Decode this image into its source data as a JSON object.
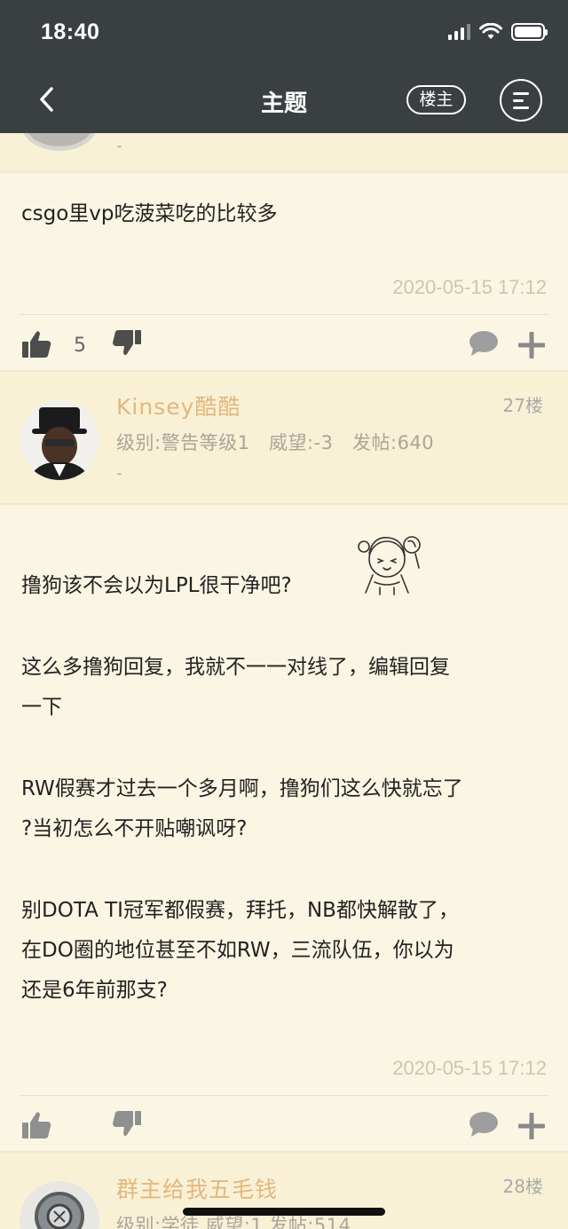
{
  "status": {
    "time": "18:40"
  },
  "nav": {
    "title": "主题",
    "louzhu_label": "楼主"
  },
  "prev_post": {
    "meta_dash": "-",
    "text": "csgo里vp吃菠菜吃的比较多",
    "timestamp": "2020-05-15 17:12",
    "likes": "5"
  },
  "post27": {
    "username": "Kinsey酷酷",
    "floor": "27楼",
    "level": "级别:警告等级1",
    "prestige": "威望:-3",
    "posts": "发帖:640",
    "dash": "-",
    "lines": [
      "撸狗该不会以为LPL很干净吧?",
      "这么多撸狗回复，我就不一一对线了，编辑回复",
      "一下",
      "RW假赛才过去一个多月啊，撸狗们这么快就忘了",
      "?当初怎么不开贴嘲讽呀?",
      "别DOTA TI冠军都假赛，拜托，NB都快解散了，",
      "在DO圈的地位甚至不如RW，三流队伍，你以为",
      "还是6年前那支?"
    ],
    "timestamp": "2020-05-15 17:12"
  },
  "post28": {
    "username": "群主给我五毛钱",
    "floor": "28楼",
    "meta": "级别:学徒  威望:1  发帖:514"
  },
  "colors": {
    "topbar": "#3a3f42",
    "background": "#fbf6e3",
    "username": "#e3b77d"
  }
}
